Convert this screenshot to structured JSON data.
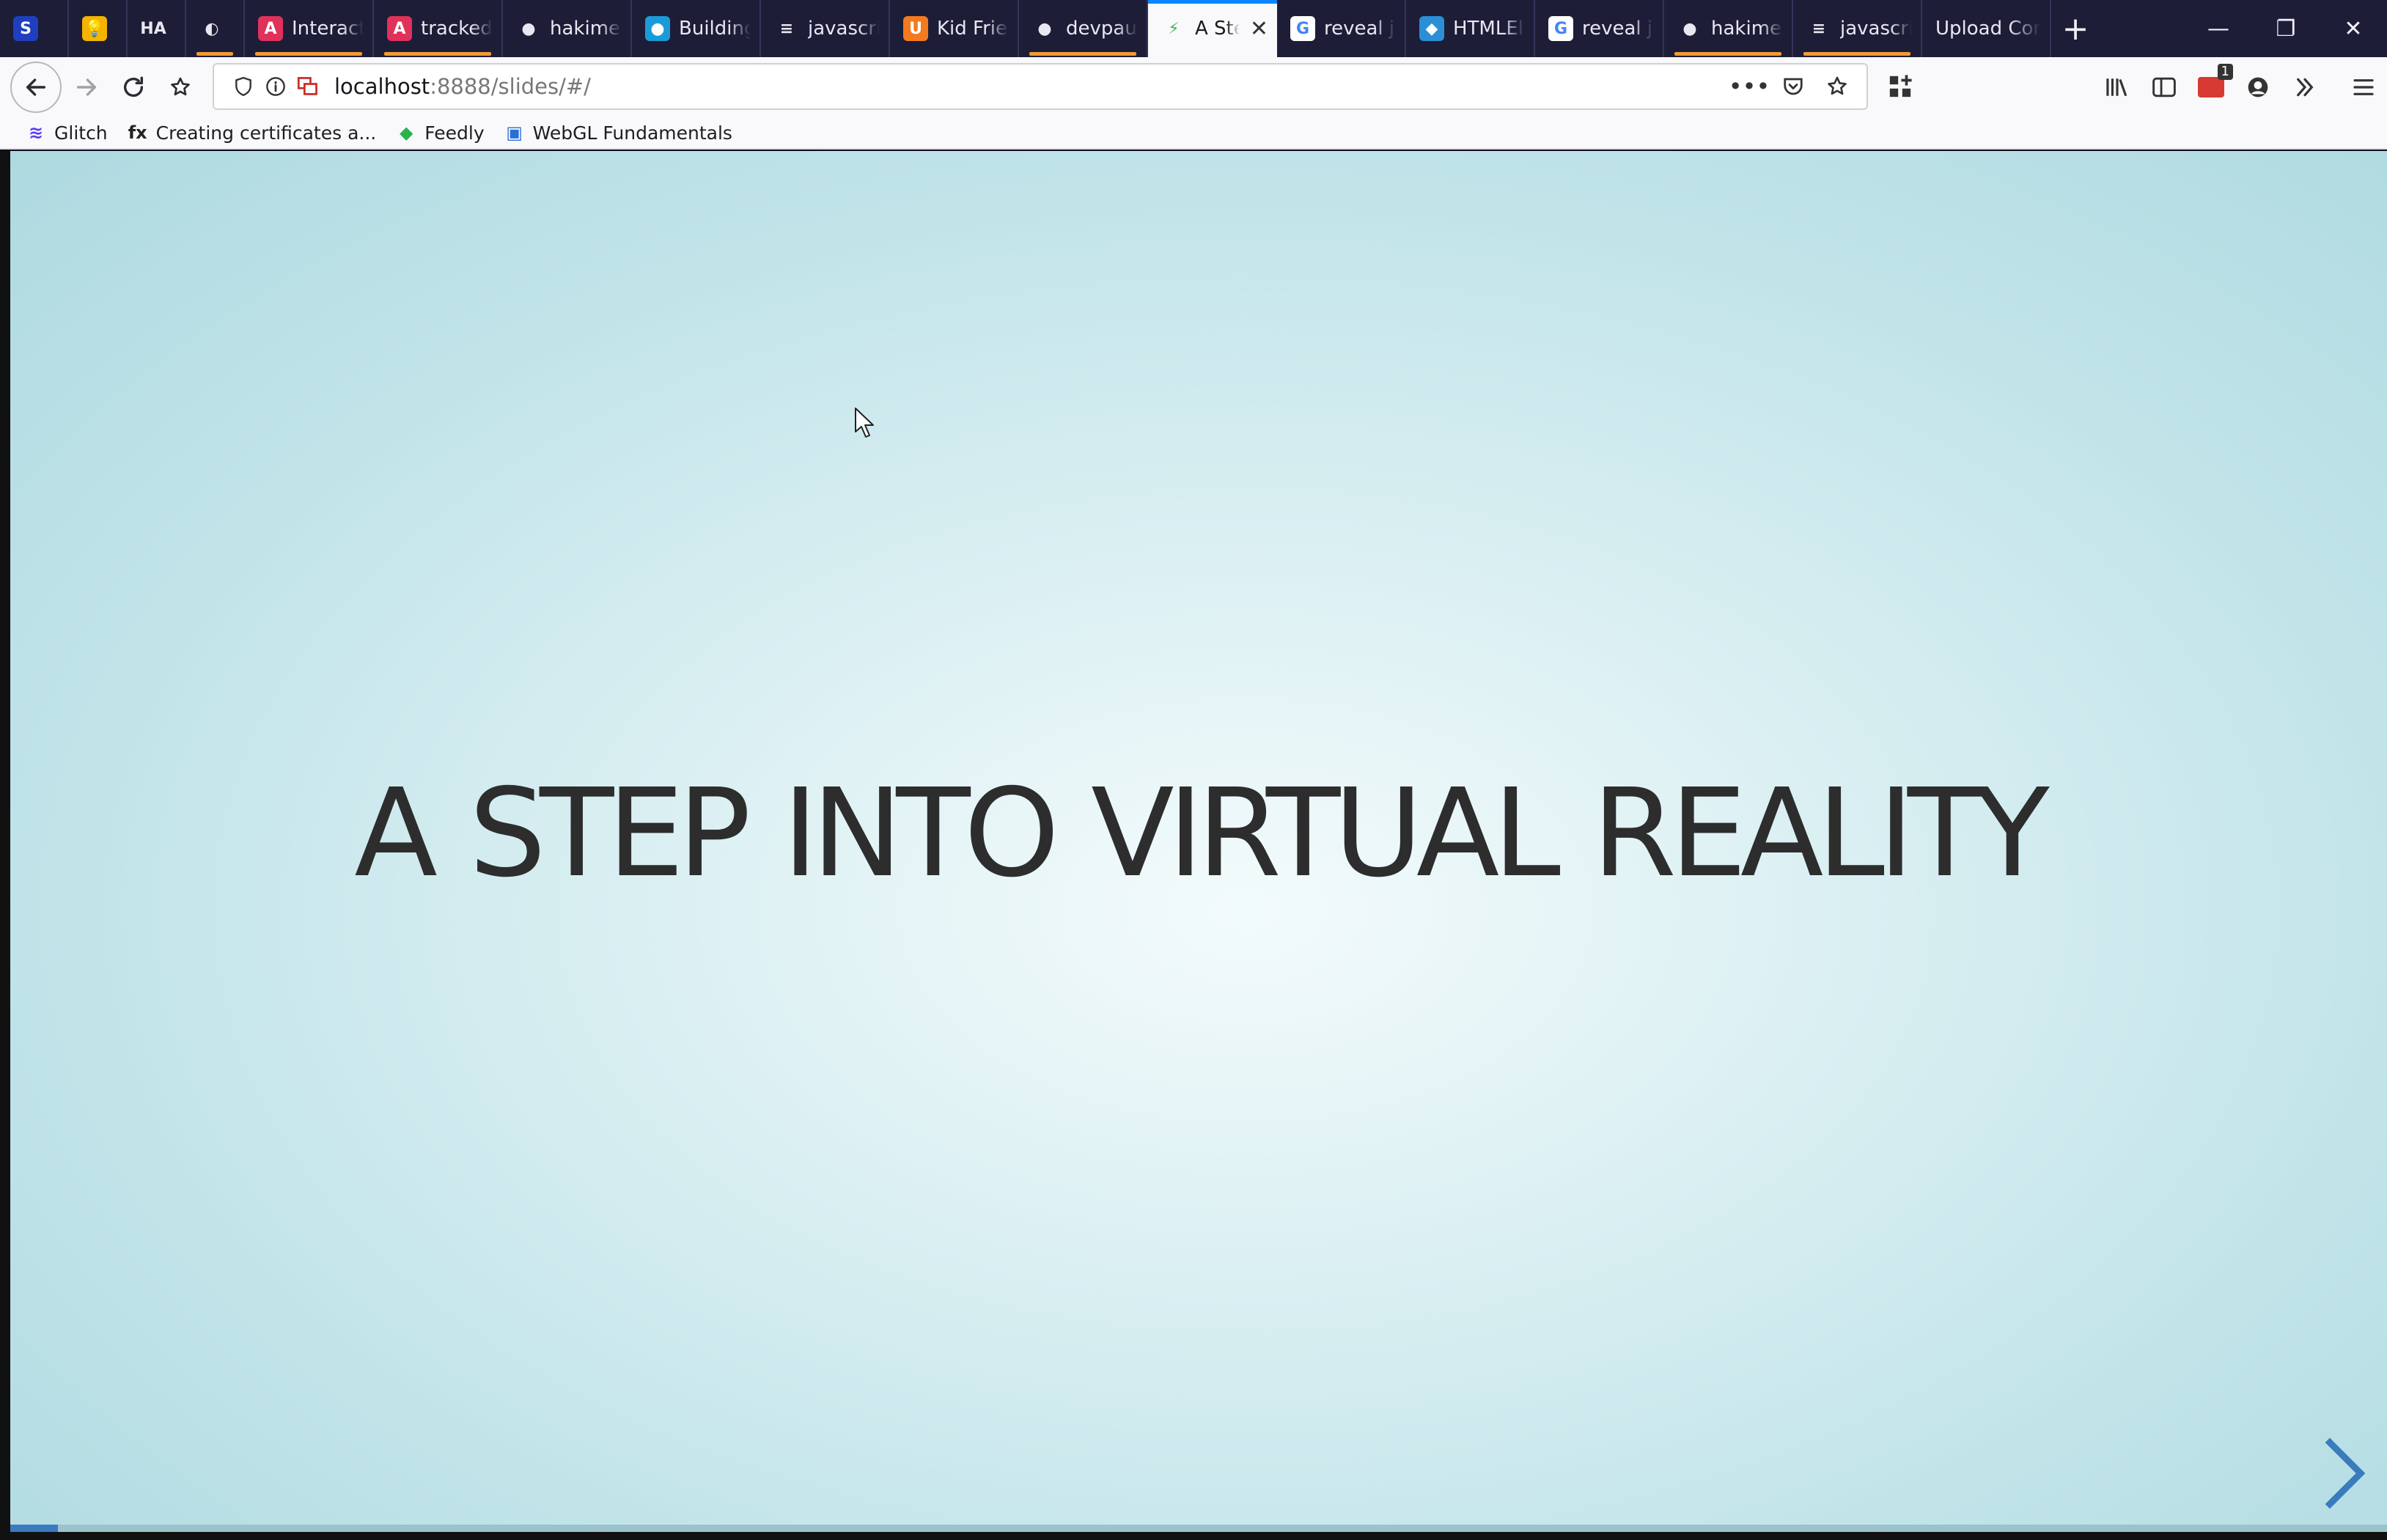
{
  "browser": {
    "tabs": [
      {
        "title": "",
        "icon": "S",
        "color": "#1f3fbf",
        "underline": false,
        "width": 94
      },
      {
        "title": "",
        "icon": "💡",
        "color": "#f5b400",
        "underline": false,
        "width": 80
      },
      {
        "title": "",
        "icon": "HA",
        "color": "#1d1d38",
        "underline": false,
        "width": 80
      },
      {
        "title": "",
        "icon": "◐",
        "color": "#1d1d38",
        "underline": true,
        "width": 80
      },
      {
        "title": "Interacti",
        "icon": "A",
        "color": "#e0315a",
        "underline": true,
        "width": 176
      },
      {
        "title": "tracked-",
        "icon": "A",
        "color": "#e0315a",
        "underline": true,
        "width": 176
      },
      {
        "title": "hakimel/",
        "icon": "●",
        "color": "#1d1d38",
        "underline": false,
        "width": 176
      },
      {
        "title": "Building",
        "icon": "●",
        "color": "#1a9bd8",
        "underline": false,
        "width": 176
      },
      {
        "title": "javascrip",
        "icon": "≡",
        "color": "#1d1d38",
        "underline": false,
        "width": 176
      },
      {
        "title": "Kid Frien",
        "icon": "U",
        "color": "#f47a20",
        "underline": false,
        "width": 176
      },
      {
        "title": "devpaul/",
        "icon": "●",
        "color": "#1d1d38",
        "underline": true,
        "width": 176
      },
      {
        "title": "A Ste",
        "icon": "⚡",
        "color": "#f9f9fb",
        "underline": false,
        "width": 176,
        "active": true
      },
      {
        "title": "reveal js",
        "icon": "G",
        "color": "#ffffff",
        "underline": false,
        "width": 176
      },
      {
        "title": "HTMLEle",
        "icon": "◆",
        "color": "#2b8fd6",
        "underline": false,
        "width": 176
      },
      {
        "title": "reveal js",
        "icon": "G",
        "color": "#ffffff",
        "underline": false,
        "width": 176
      },
      {
        "title": "hakimel/",
        "icon": "●",
        "color": "#1d1d38",
        "underline": true,
        "width": 176
      },
      {
        "title": "javascrip",
        "icon": "≡",
        "color": "#1d1d38",
        "underline": true,
        "width": 176
      },
      {
        "title": "Upload Com",
        "icon": "",
        "color": "#1d1d38",
        "underline": false,
        "width": 176
      }
    ],
    "url_host": "localhost",
    "url_path": ":8888/slides/#/",
    "bookmarks": [
      {
        "label": "Glitch",
        "icon": "≋",
        "color": "#5b3df5"
      },
      {
        "label": "Creating certificates a...",
        "icon": "fx",
        "color": "#222222"
      },
      {
        "label": "Feedly",
        "icon": "◆",
        "color": "#2bb24c"
      },
      {
        "label": "WebGL Fundamentals",
        "icon": "▣",
        "color": "#2a6fd6"
      }
    ],
    "extension_badge": "1"
  },
  "slide": {
    "title": "A STEP INTO VIRTUAL REALITY",
    "progress": 0.02,
    "accent_color": "#3a7bbf"
  }
}
